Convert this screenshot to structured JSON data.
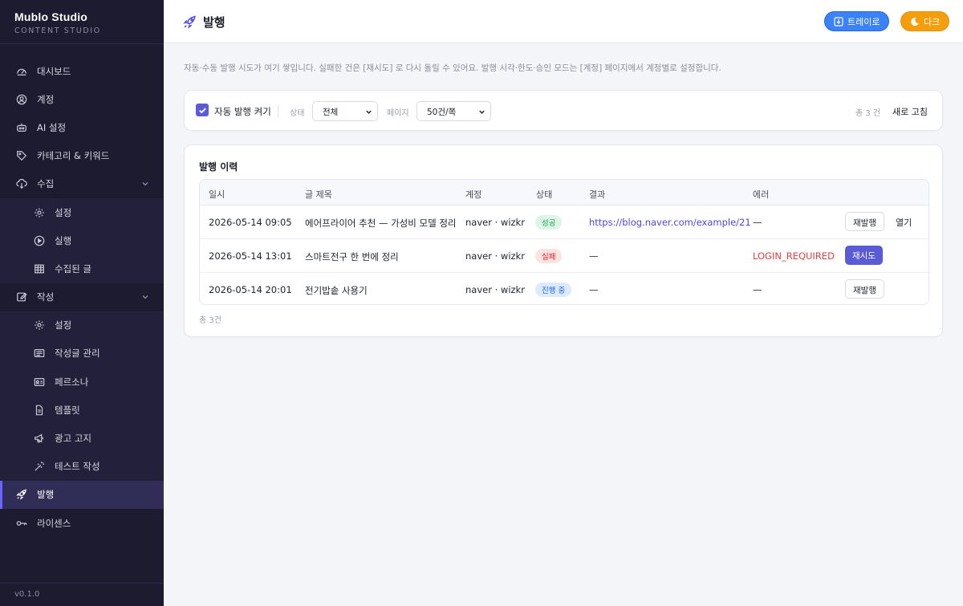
{
  "brand": {
    "title": "Mublo Studio",
    "subtitle": "CONTENT STUDIO"
  },
  "sidebar": {
    "items": [
      {
        "label": "대시보드",
        "icon": "gauge-icon"
      },
      {
        "label": "계정",
        "icon": "user-circle-icon"
      },
      {
        "label": "AI 설정",
        "icon": "robot-icon"
      },
      {
        "label": "카테고리 & 키워드",
        "icon": "tag-icon"
      },
      {
        "label": "수집",
        "icon": "cloud-download-icon",
        "expanded": true
      },
      {
        "label": "설정",
        "icon": "gear-icon",
        "sub": true
      },
      {
        "label": "실행",
        "icon": "play-circle-icon",
        "sub": true
      },
      {
        "label": "수집된 글",
        "icon": "table-icon",
        "sub": true
      },
      {
        "label": "작성",
        "icon": "edit-icon",
        "expanded": true
      },
      {
        "label": "설정",
        "icon": "gear-icon",
        "sub": true
      },
      {
        "label": "작성글 관리",
        "icon": "list-icon",
        "sub": true
      },
      {
        "label": "페르소나",
        "icon": "id-card-icon",
        "sub": true
      },
      {
        "label": "템플릿",
        "icon": "file-icon",
        "sub": true
      },
      {
        "label": "광고 고지",
        "icon": "megaphone-icon",
        "sub": true
      },
      {
        "label": "테스트 작성",
        "icon": "magic-wand-icon",
        "sub": true
      },
      {
        "label": "발행",
        "icon": "rocket-icon",
        "active": true
      },
      {
        "label": "라이센스",
        "icon": "key-icon"
      }
    ],
    "version": "v0.1.0"
  },
  "header": {
    "title": "발행",
    "tray_label": "트레이로",
    "dark_label": "다크"
  },
  "description": "자동·수동 발행 시도가 여기 쌓입니다. 실패한 건은 [재시도] 로 다시 돌릴 수 있어요. 발행 시각·한도·승인 모드는 [계정] 페이지에서 계정별로 설정합니다.",
  "filters": {
    "auto_publish_label": "자동 발행 켜기",
    "auto_publish_checked": true,
    "status_label": "상태",
    "status_value": "전체",
    "page_label": "페이지",
    "page_value": "50건/쪽",
    "total_label": "총 3 건",
    "refresh_label": "새로 고침"
  },
  "history": {
    "title": "발행 이력",
    "columns": [
      "일시",
      "글 제목",
      "계정",
      "상태",
      "결과",
      "에러"
    ],
    "rows": [
      {
        "date": "2026-05-14 09:05",
        "title": "에어프라이어 추천 — 가성비 모델 정리",
        "account": "naver · wizkr",
        "status": "성공",
        "status_type": "success",
        "result": "https://blog.naver.com/example/21",
        "error": "—",
        "action": "재발행",
        "extra": "열기"
      },
      {
        "date": "2026-05-14 13:01",
        "title": "스마트전구 한 번에 정리",
        "account": "naver · wizkr",
        "status": "실패",
        "status_type": "fail",
        "result": "—",
        "error": "LOGIN_REQUIRED",
        "action": "재시도"
      },
      {
        "date": "2026-05-14 20:01",
        "title": "전기밥솥 사용기",
        "account": "naver · wizkr",
        "status": "진행 중",
        "status_type": "progress",
        "result": "—",
        "error": "—",
        "action": "재발행"
      }
    ],
    "total_label": "총 3건"
  },
  "colors": {
    "accent": "#5b5bd6",
    "sidebar_bg": "#1d1b30",
    "tray": "#3b82f6",
    "dark_btn": "#f59e0b",
    "error": "#e53e3e"
  }
}
